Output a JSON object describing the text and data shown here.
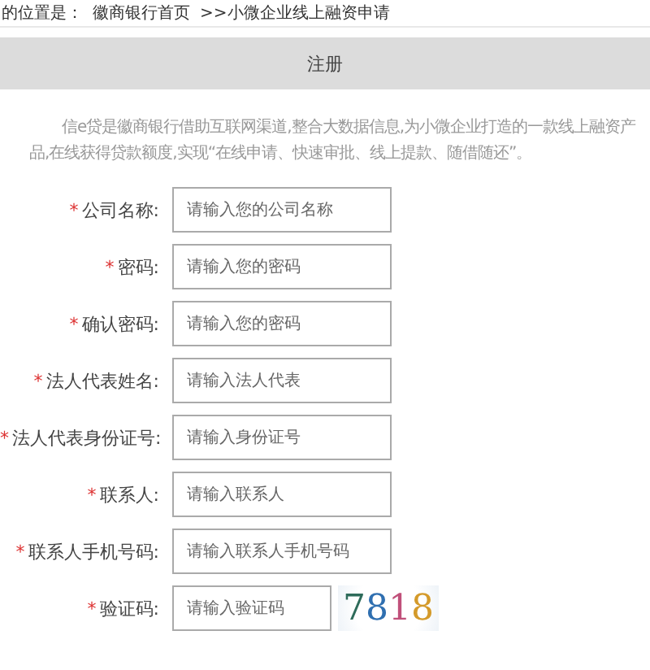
{
  "breadcrumb": {
    "prefix": "的位置是：",
    "home": "徽商银行首页",
    "current": ">>小微企业线上融资申请"
  },
  "header": {
    "title": "注册"
  },
  "intro": "信e贷是徽商银行借助互联网渠道,整合大数据信息,为小微企业打造的一款线上融资产品,在线获得贷款额度,实现“在线申请、快速审批、线上提款、随借随还”。",
  "fields": [
    {
      "kind": "text",
      "mark": "*",
      "label": "公司名称:",
      "placeholder": "请输入您的公司名称"
    },
    {
      "kind": "password",
      "mark": "*",
      "label": "密码:",
      "placeholder": "请输入您的密码"
    },
    {
      "kind": "password",
      "mark": "*",
      "label": "确认密码:",
      "placeholder": "请输入您的密码"
    },
    {
      "kind": "text",
      "mark": "*",
      "label": "法人代表姓名:",
      "placeholder": "请输入法人代表"
    },
    {
      "kind": "text",
      "mark": "*",
      "label": "法人代表身份证号:",
      "placeholder": "请输入身份证号"
    },
    {
      "kind": "text",
      "mark": "*",
      "label": "联系人:",
      "placeholder": "请输入联系人"
    },
    {
      "kind": "text",
      "mark": "*",
      "label": "联系人手机号码:",
      "placeholder": "请输入联系人手机号码"
    },
    {
      "kind": "captcha",
      "mark": "*",
      "label": "验证码:",
      "placeholder": "请输入验证码",
      "code": "7818"
    }
  ]
}
